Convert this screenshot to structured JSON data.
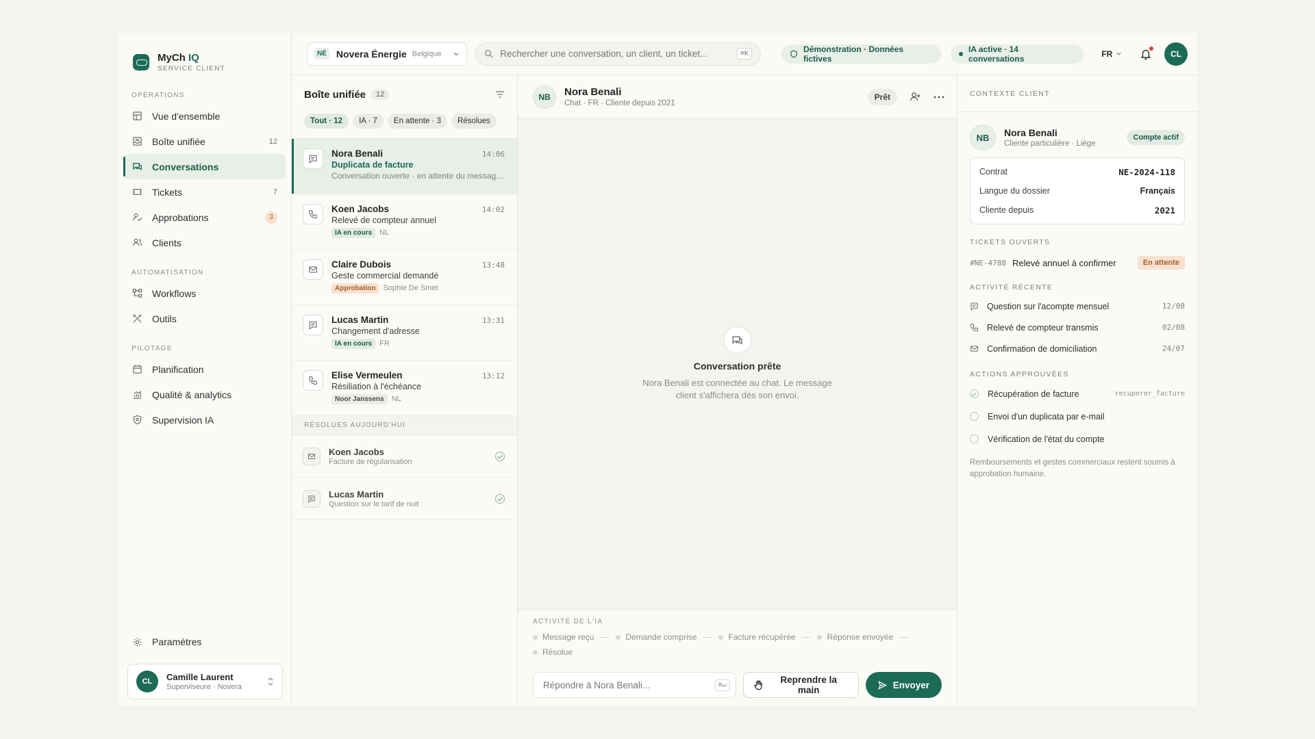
{
  "brand": {
    "name": "MyCh",
    "name_accent": "IQ",
    "subtitle": "SERVICE CLIENT"
  },
  "sidebar": {
    "sections": [
      {
        "title": "OPÉRATIONS",
        "items": [
          {
            "label": "Vue d'ensemble",
            "icon": "dashboard-icon",
            "count": ""
          },
          {
            "label": "Boîte unifiée",
            "icon": "inbox-icon",
            "count": "12"
          },
          {
            "label": "Conversations",
            "icon": "chat-icon",
            "count": "",
            "active": true
          },
          {
            "label": "Tickets",
            "icon": "ticket-icon",
            "count": "7"
          },
          {
            "label": "Approbations",
            "icon": "approval-icon",
            "count": "3"
          },
          {
            "label": "Clients",
            "icon": "users-icon",
            "count": ""
          }
        ]
      },
      {
        "title": "AUTOMATISATION",
        "items": [
          {
            "label": "Workflows",
            "icon": "workflow-icon"
          },
          {
            "label": "Outils",
            "icon": "tools-icon"
          }
        ]
      },
      {
        "title": "PILOTAGE",
        "items": [
          {
            "label": "Planification",
            "icon": "calendar-icon"
          },
          {
            "label": "Qualité & analytics",
            "icon": "analytics-icon"
          },
          {
            "label": "Supervision IA",
            "icon": "shield-icon"
          }
        ]
      }
    ],
    "settings_label": "Paramètres",
    "user": {
      "initials": "CL",
      "name": "Camille Laurent",
      "role": "Superviseure · Novera"
    }
  },
  "topbar": {
    "org_badge": "NÉ",
    "org_name": "Novera Énergie",
    "org_region": "Belgique",
    "search_placeholder": "Rechercher une conversation, un client, un ticket...",
    "search_shortcut": "⌘K",
    "demo_chip": "Démonstration · Données fictives",
    "ai_chip": "IA active · 14 conversations",
    "language": "FR",
    "user_initials": "CL"
  },
  "inbox": {
    "title": "Boîte unifiée",
    "count": "12",
    "filters": [
      "Tout · 12",
      "IA · 7",
      "En attente · 3",
      "Résolues"
    ],
    "conversations": [
      {
        "name": "Nora Benali",
        "time": "14:06",
        "subject": "Duplicata de facture",
        "preview": "Conversation ouverte · en attente du message client",
        "channel": "chat",
        "tag": "",
        "tag_type": "",
        "extra": ""
      },
      {
        "name": "Koen Jacobs",
        "time": "14:02",
        "subject": "Relevé de compteur annuel",
        "preview": "",
        "channel": "phone",
        "tag": "IA en cours",
        "tag_type": "ai",
        "extra": "NL"
      },
      {
        "name": "Claire Dubois",
        "time": "13:48",
        "subject": "Geste commercial demandé",
        "preview": "",
        "channel": "mail",
        "tag": "Approbation",
        "tag_type": "appro",
        "extra": "Sophie De Smet"
      },
      {
        "name": "Lucas Martin",
        "time": "13:31",
        "subject": "Changement d'adresse",
        "preview": "",
        "channel": "chat",
        "tag": "IA en cours",
        "tag_type": "ai",
        "extra": "FR"
      },
      {
        "name": "Elise Vermeulen",
        "time": "13:12",
        "subject": "Résiliation à l'échéance",
        "preview": "",
        "channel": "phone",
        "tag": "Noor Janssens",
        "tag_type": "agent",
        "extra": "NL"
      }
    ],
    "resolved_title": "RÉSOLUES AUJOURD'HUI",
    "resolved": [
      {
        "name": "Koen Jacobs",
        "subject": "Facture de régularisation",
        "channel": "mail"
      },
      {
        "name": "Lucas Martin",
        "subject": "Question sur le tarif de nuit",
        "channel": "chat"
      }
    ]
  },
  "chat": {
    "initials": "NB",
    "name": "Nora Benali",
    "meta": "Chat · FR · Cliente depuis 2021",
    "status": "Prêt",
    "empty_title": "Conversation prête",
    "empty_text": "Nora Benali est connectée au chat. Le message client s'affichera dès son envoi.",
    "ai_activity_title": "ACTIVITÉ DE L'IA",
    "steps": [
      "Message reçu",
      "Demande comprise",
      "Facture récupérée",
      "Réponse envoyée",
      "Résolue"
    ],
    "reply_placeholder": "Répondre à Nora Benali...",
    "reply_shortcut": "⌘↵",
    "takeover_label": "Reprendre la main",
    "send_label": "Envoyer"
  },
  "context": {
    "title": "CONTEXTE CLIENT",
    "client": {
      "initials": "NB",
      "name": "Nora Benali",
      "sub": "Cliente particulière · Liège",
      "status": "Compte actif"
    },
    "info": [
      {
        "label": "Contrat",
        "value": "NE-2024-118",
        "mono": true
      },
      {
        "label": "Langue du dossier",
        "value": "Français",
        "mono": false
      },
      {
        "label": "Cliente depuis",
        "value": "2021",
        "mono": true
      }
    ],
    "tickets_title": "TICKETS OUVERTS",
    "ticket": {
      "id": "#NE-4788",
      "label": "Relevé annuel à confirmer",
      "status": "En attente"
    },
    "activity_title": "ACTIVITÉ RÉCENTE",
    "activity": [
      {
        "label": "Question sur l'acompte mensuel",
        "date": "12/08",
        "icon": "chat"
      },
      {
        "label": "Relevé de compteur transmis",
        "date": "02/08",
        "icon": "phone"
      },
      {
        "label": "Confirmation de domiciliation",
        "date": "24/07",
        "icon": "mail"
      }
    ],
    "actions_title": "ACTIONS APPROUVÉES",
    "actions": [
      {
        "label": "Récupération de facture",
        "code": "recuperer_facture",
        "done": true
      },
      {
        "label": "Envoi d'un duplicata par e-mail",
        "code": "",
        "done": false
      },
      {
        "label": "Vérification de l'état du compte",
        "code": "",
        "done": false
      }
    ],
    "note": "Remboursements et gestes commerciaux restent soumis à approbation humaine."
  },
  "colors": {
    "accent": "#1b6b55",
    "accent_soft": "#e8efe9",
    "warning": "#a4602c",
    "warning_soft": "#f7e2cf",
    "alert": "#d9403a"
  }
}
